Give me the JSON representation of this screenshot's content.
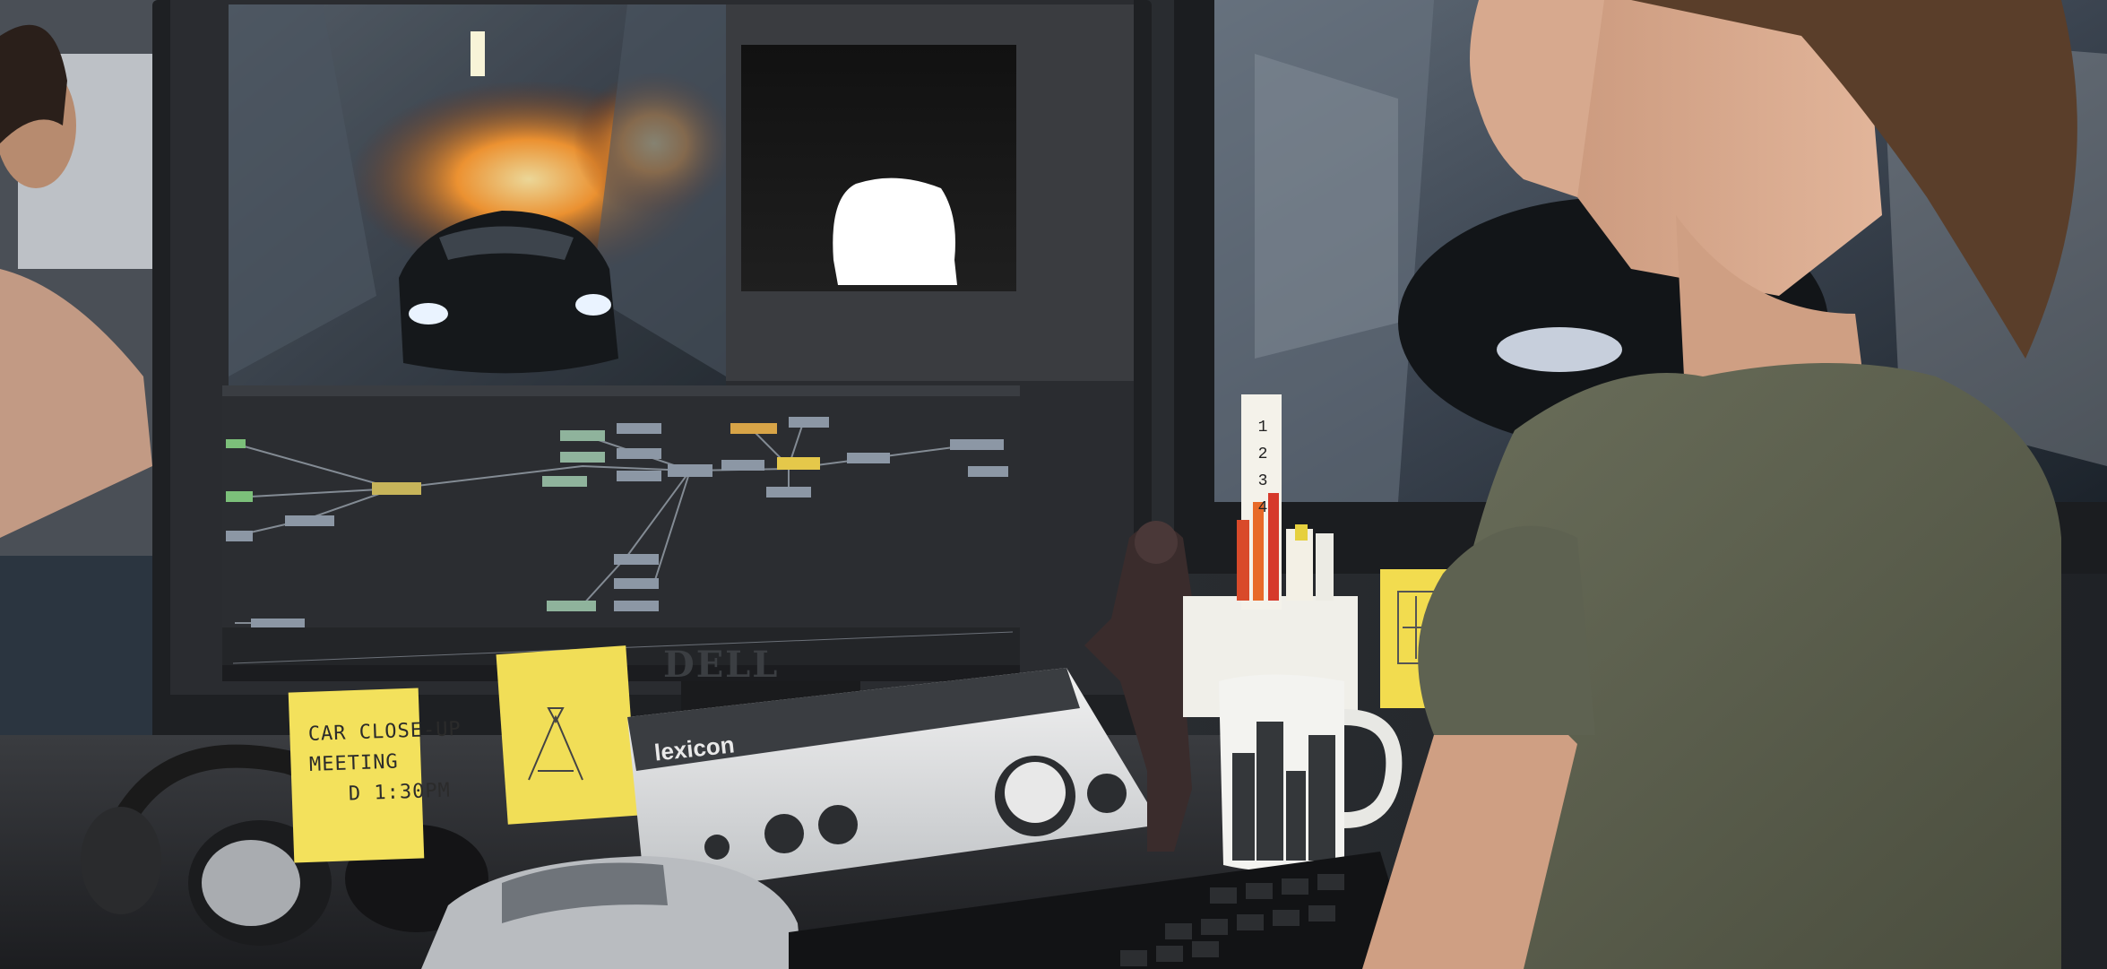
{
  "sticky_notes": {
    "left_note_text": "CAR CLOSE-UP\nMEETING\n   D 1:30PM"
  },
  "monitor": {
    "logo": "DELL"
  },
  "audio_interface": {
    "brand": "lexicon"
  },
  "ruler": {
    "numbers": "1\n2\n3\n4"
  },
  "colors": {
    "sticky_note": "#f3e15c",
    "shirt": "#5b5f4d",
    "node_graph_bg": "#2b2d31",
    "viewer_bg": "#141414"
  }
}
